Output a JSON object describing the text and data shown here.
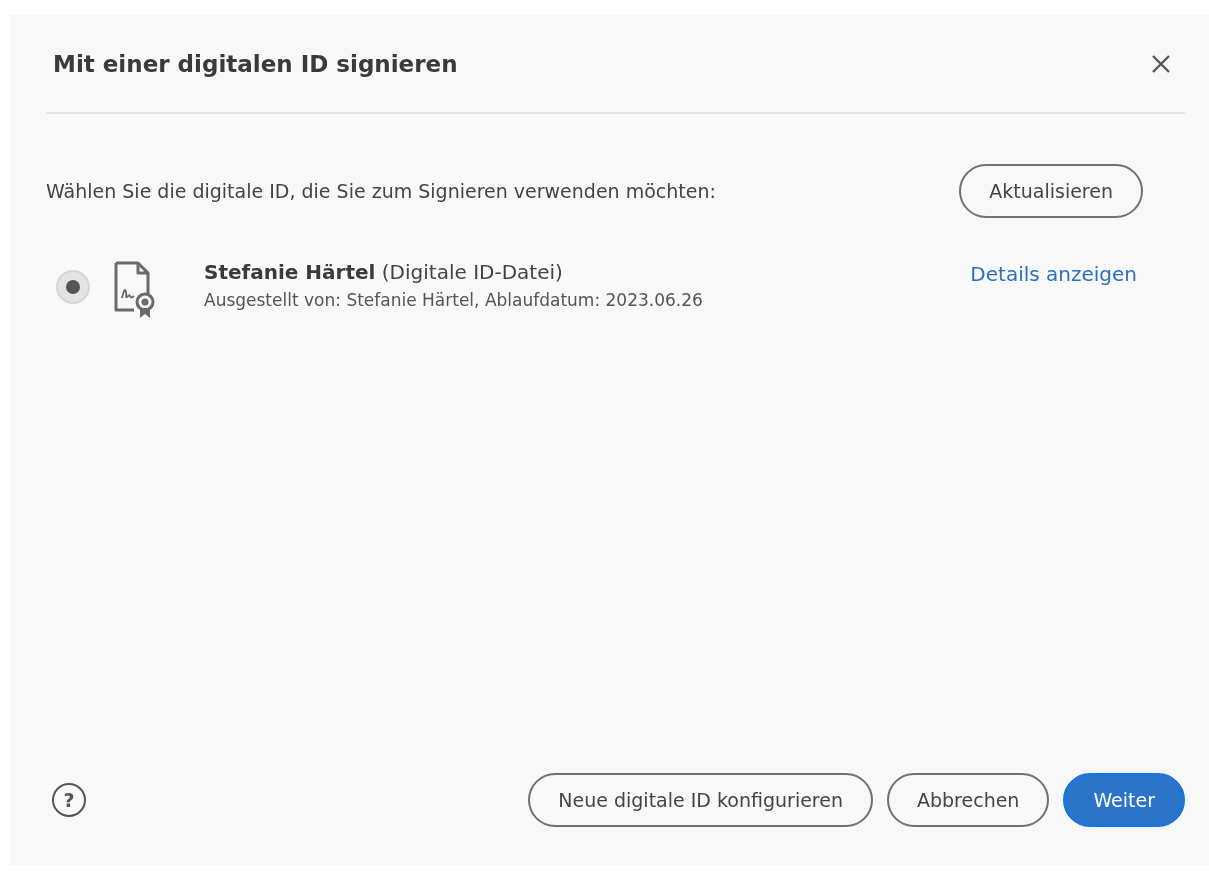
{
  "dialog": {
    "title": "Mit einer digitalen ID signieren",
    "prompt": "Wählen Sie die digitale ID, die Sie zum Signieren verwenden möchten:",
    "refresh_button": "Aktualisieren",
    "ids": [
      {
        "name": "Stefanie Härtel",
        "type": "(Digitale ID-Datei)",
        "details": "Ausgestellt von: Stefanie Härtel, Ablaufdatum: 2023.06.26",
        "link": "Details anzeigen",
        "selected": true
      }
    ],
    "help": "?",
    "buttons": [
      {
        "label": "Neue digitale ID konfigurieren",
        "kind": "secondary"
      },
      {
        "label": "Abbrechen",
        "kind": "secondary"
      },
      {
        "label": "Weiter",
        "kind": "primary"
      }
    ]
  }
}
